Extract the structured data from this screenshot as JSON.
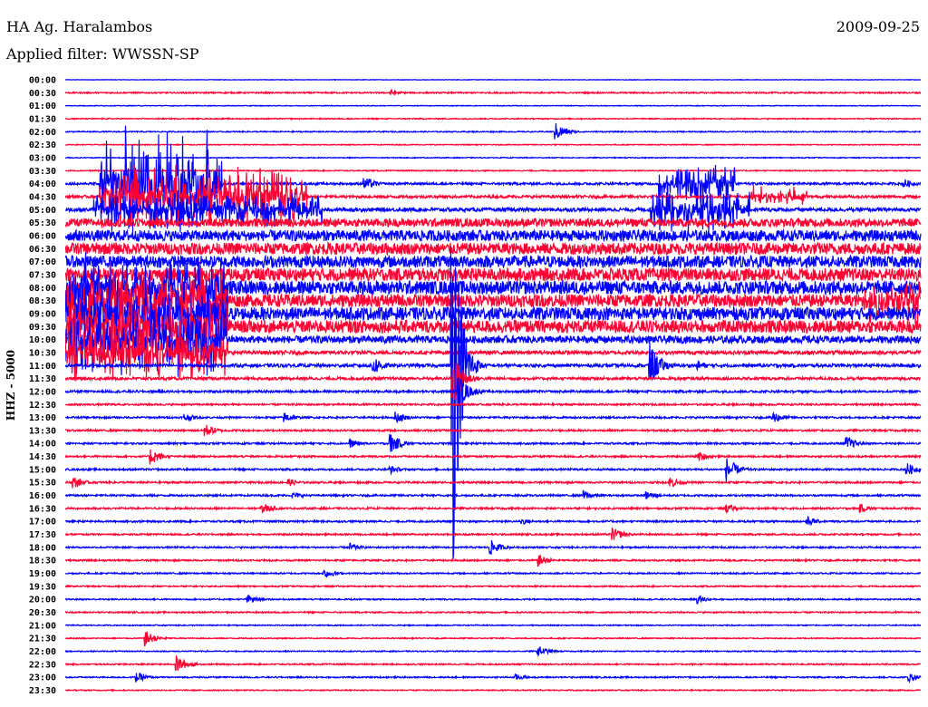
{
  "header": {
    "station": "HA Ag. Haralambos",
    "date": "2009-09-25",
    "filter": "Applied filter: WWSSN-SP"
  },
  "chart_data": {
    "type": "line",
    "title": "HA Ag. Haralambos 2009-09-25 helicorder",
    "ylabel": "HHZ - 5000",
    "xlabel": "",
    "minutes_per_row": 30,
    "colors": {
      "even": "#0000ff",
      "odd": "#ff0033"
    },
    "row_labels": [
      "00:00",
      "00:30",
      "01:00",
      "01:30",
      "02:00",
      "02:30",
      "03:00",
      "03:30",
      "04:00",
      "04:30",
      "05:00",
      "05:30",
      "06:00",
      "06:30",
      "07:00",
      "07:30",
      "08:00",
      "08:30",
      "09:00",
      "09:30",
      "10:00",
      "10:30",
      "11:00",
      "11:30",
      "12:00",
      "12:30",
      "13:00",
      "13:30",
      "14:00",
      "14:30",
      "15:00",
      "15:30",
      "16:00",
      "16:30",
      "17:00",
      "17:30",
      "18:00",
      "18:30",
      "19:00",
      "19:30",
      "20:00",
      "20:30",
      "21:00",
      "21:30",
      "22:00",
      "22:30",
      "23:00",
      "23:30"
    ],
    "base_amplitude": [
      0.6,
      1.5,
      0.8,
      1.2,
      1.2,
      1,
      1,
      1.2,
      2.5,
      3,
      4,
      9,
      12,
      13,
      13,
      14,
      15,
      14,
      14,
      14,
      8,
      4,
      3.5,
      3,
      2.5,
      2,
      2,
      2,
      2,
      2,
      2,
      2,
      2,
      2,
      2,
      1.8,
      1.8,
      1.8,
      1.6,
      1.5,
      1.5,
      1.5,
      1.2,
      1.2,
      1.2,
      1.5,
      1.5,
      1.2
    ],
    "bursts": [
      {
        "row": 8,
        "start": 1.2,
        "end": 5.5,
        "amp": 55
      },
      {
        "row": 8,
        "start": 20.8,
        "end": 23.5,
        "amp": 22
      },
      {
        "row": 9,
        "start": 1.2,
        "end": 8.5,
        "amp": 30
      },
      {
        "row": 9,
        "start": 24,
        "end": 26,
        "amp": 10
      },
      {
        "row": 10,
        "start": 1,
        "end": 9,
        "amp": 18
      },
      {
        "row": 10,
        "start": 20.5,
        "end": 24,
        "amp": 22
      },
      {
        "row": 16,
        "start": 0,
        "end": 5.7,
        "amp": 30
      },
      {
        "row": 17,
        "start": 0,
        "end": 5.7,
        "amp": 32
      },
      {
        "row": 18,
        "start": 0,
        "end": 5.7,
        "amp": 32
      },
      {
        "row": 19,
        "start": 0,
        "end": 5.7,
        "amp": 30
      },
      {
        "row": 20,
        "start": 0,
        "end": 5.7,
        "amp": 35
      },
      {
        "row": 21,
        "start": 0,
        "end": 5.7,
        "amp": 30
      },
      {
        "row": 17,
        "start": 28,
        "end": 30,
        "amp": 25
      }
    ],
    "events": [
      {
        "row": 1,
        "minute": 11.4,
        "amp": 4
      },
      {
        "row": 4,
        "minute": 17.2,
        "amp": 10
      },
      {
        "row": 8,
        "minute": 10.5,
        "amp": 8
      },
      {
        "row": 8,
        "minute": 29.4,
        "amp": 6
      },
      {
        "row": 22,
        "minute": 13.57,
        "amp": 260
      },
      {
        "row": 23,
        "minute": 13.6,
        "amp": 30
      },
      {
        "row": 24,
        "minute": 13.8,
        "amp": 18
      },
      {
        "row": 22,
        "minute": 10.8,
        "amp": 12
      },
      {
        "row": 22,
        "minute": 20.5,
        "amp": 25
      },
      {
        "row": 22,
        "minute": 22.2,
        "amp": 6
      },
      {
        "row": 26,
        "minute": 4.2,
        "amp": 5
      },
      {
        "row": 26,
        "minute": 7.7,
        "amp": 6
      },
      {
        "row": 26,
        "minute": 11.6,
        "amp": 7
      },
      {
        "row": 26,
        "minute": 24.8,
        "amp": 8
      },
      {
        "row": 27,
        "minute": 4.9,
        "amp": 8
      },
      {
        "row": 28,
        "minute": 10,
        "amp": 5
      },
      {
        "row": 28,
        "minute": 11.4,
        "amp": 12
      },
      {
        "row": 28,
        "minute": 27.4,
        "amp": 8
      },
      {
        "row": 29,
        "minute": 3,
        "amp": 10
      },
      {
        "row": 29,
        "minute": 22.2,
        "amp": 6
      },
      {
        "row": 30,
        "minute": 11.4,
        "amp": 5
      },
      {
        "row": 30,
        "minute": 23.2,
        "amp": 14
      },
      {
        "row": 30,
        "minute": 29.5,
        "amp": 8
      },
      {
        "row": 31,
        "minute": 0.3,
        "amp": 7
      },
      {
        "row": 31,
        "minute": 7.8,
        "amp": 5
      },
      {
        "row": 31,
        "minute": 21.2,
        "amp": 7
      },
      {
        "row": 32,
        "minute": 8,
        "amp": 4
      },
      {
        "row": 32,
        "minute": 18.2,
        "amp": 6
      },
      {
        "row": 32,
        "minute": 20.4,
        "amp": 5
      },
      {
        "row": 33,
        "minute": 6.9,
        "amp": 7
      },
      {
        "row": 33,
        "minute": 23.2,
        "amp": 5
      },
      {
        "row": 33,
        "minute": 27.9,
        "amp": 5
      },
      {
        "row": 34,
        "minute": 16,
        "amp": 4
      },
      {
        "row": 34,
        "minute": 26,
        "amp": 6
      },
      {
        "row": 35,
        "minute": 19.2,
        "amp": 8
      },
      {
        "row": 36,
        "minute": 10,
        "amp": 5
      },
      {
        "row": 36,
        "minute": 14.9,
        "amp": 9
      },
      {
        "row": 37,
        "minute": 16.6,
        "amp": 7
      },
      {
        "row": 38,
        "minute": 9.1,
        "amp": 6
      },
      {
        "row": 40,
        "minute": 6.4,
        "amp": 5
      },
      {
        "row": 40,
        "minute": 22.2,
        "amp": 5
      },
      {
        "row": 43,
        "minute": 2.8,
        "amp": 9
      },
      {
        "row": 44,
        "minute": 16.6,
        "amp": 6
      },
      {
        "row": 45,
        "minute": 3.9,
        "amp": 10
      },
      {
        "row": 46,
        "minute": 2.5,
        "amp": 6
      },
      {
        "row": 46,
        "minute": 15.8,
        "amp": 4
      },
      {
        "row": 46,
        "minute": 29.6,
        "amp": 5
      }
    ]
  }
}
